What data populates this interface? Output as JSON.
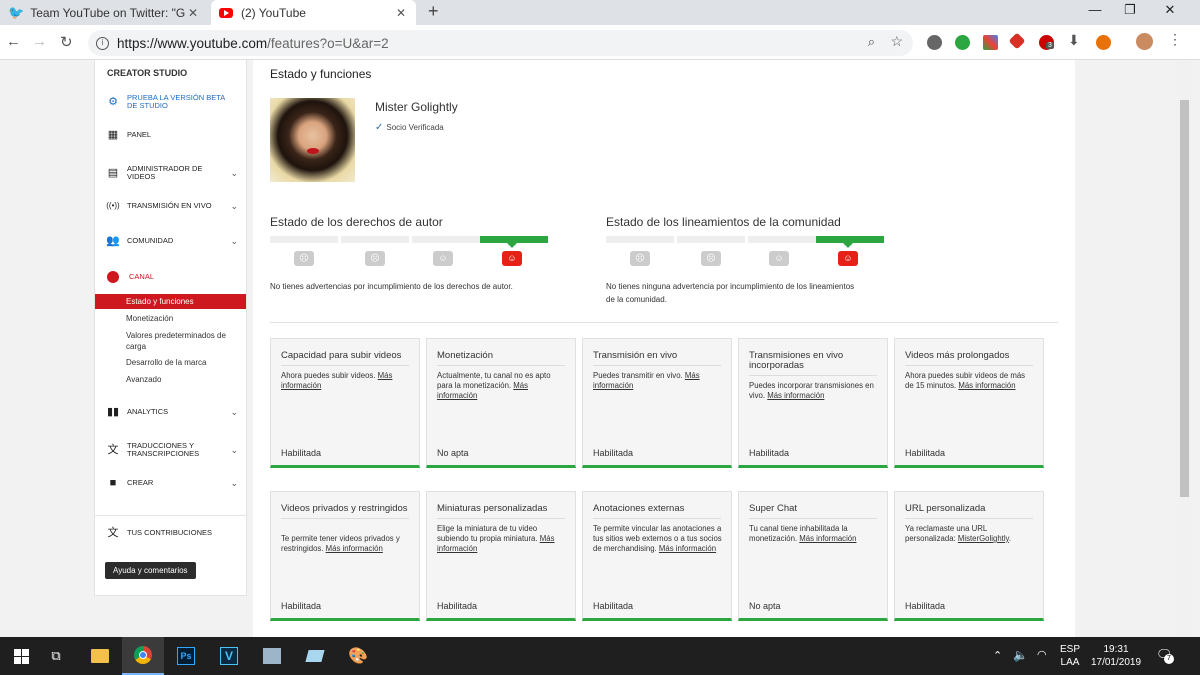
{
  "browser": {
    "tabs": [
      {
        "title": "Team YouTube on Twitter: \"Gracias",
        "icon": "twitter-icon",
        "color": "#1da1f2"
      },
      {
        "title": "(2) YouTube",
        "icon": "youtube-icon",
        "color": "#ff0000"
      }
    ],
    "url_host": "https://www.youtube.com",
    "url_path": "/features?o=U&ar=2",
    "ext_badge": "3"
  },
  "sidebar": {
    "header": "CREATOR STUDIO",
    "beta": "PRUEBA LA VERSIÓN BETA DE STUDIO",
    "items": [
      {
        "label": "PANEL"
      },
      {
        "label": "ADMINISTRADOR DE VIDEOS"
      },
      {
        "label": "TRANSMISIÓN EN VIVO"
      },
      {
        "label": "COMUNIDAD"
      },
      {
        "label": "CANAL"
      },
      {
        "label": "ANALYTICS"
      },
      {
        "label": "TRADUCCIONES Y TRANSCRIPCIONES"
      },
      {
        "label": "CREAR"
      },
      {
        "label": "TUS CONTRIBUCIONES"
      }
    ],
    "canal_sub": [
      "Estado y funciones",
      "Monetización",
      "Valores predeterminados de carga",
      "Desarrollo de la marca",
      "Avanzado"
    ],
    "help": "Ayuda y comentarios"
  },
  "main": {
    "title": "Estado y funciones",
    "channel_name": "Mister Golightly",
    "verified": "Socio Verificada",
    "copyright": {
      "title": "Estado de los derechos de autor",
      "message": "No tienes advertencias por incumplimiento de los derechos de autor.",
      "level": 4
    },
    "community": {
      "title": "Estado de los lineamientos de la comunidad",
      "message": "No tienes ninguna advertencia por incumplimiento de los lineamientos de la comunidad.",
      "level": 4
    },
    "more_info": "Más información",
    "cards": [
      {
        "title": "Capacidad para subir videos",
        "desc": "Ahora puedes subir videos.",
        "status": "Habilitada"
      },
      {
        "title": "Monetización",
        "desc": "Actualmente, tu canal no es apto para la monetización.",
        "status": "No apta"
      },
      {
        "title": "Transmisión en vivo",
        "desc": "Puedes transmitir en vivo.",
        "status": "Habilitada"
      },
      {
        "title": "Transmisiones en vivo incorporadas",
        "desc": "Puedes incorporar transmisiones en vivo.",
        "status": "Habilitada"
      },
      {
        "title": "Videos más prolongados",
        "desc": "Ahora puedes subir videos de más de 15 minutos.",
        "status": "Habilitada"
      },
      {
        "title": "Videos privados y restringidos",
        "desc": "Te permite tener videos privados y restringidos.",
        "status": "Habilitada"
      },
      {
        "title": "Miniaturas personalizadas",
        "desc": "Elige la miniatura de tu video subiendo tu propia miniatura.",
        "status": "Habilitada"
      },
      {
        "title": "Anotaciones externas",
        "desc": "Te permite vincular las anotaciones a tus sitios web externos o a tus socios de merchandising.",
        "status": "Habilitada"
      },
      {
        "title": "Super Chat",
        "desc": "Tu canal tiene inhabilitada la monetización.",
        "status": "No apta"
      },
      {
        "title": "URL personalizada",
        "desc": "Ya reclamaste una URL personalizada:",
        "link": "MisterGolightly",
        "status": "Habilitada"
      }
    ]
  },
  "taskbar": {
    "lang": "ESP",
    "layout": "LAA",
    "time": "19:31",
    "date": "17/01/2019",
    "notif_count": "7"
  }
}
